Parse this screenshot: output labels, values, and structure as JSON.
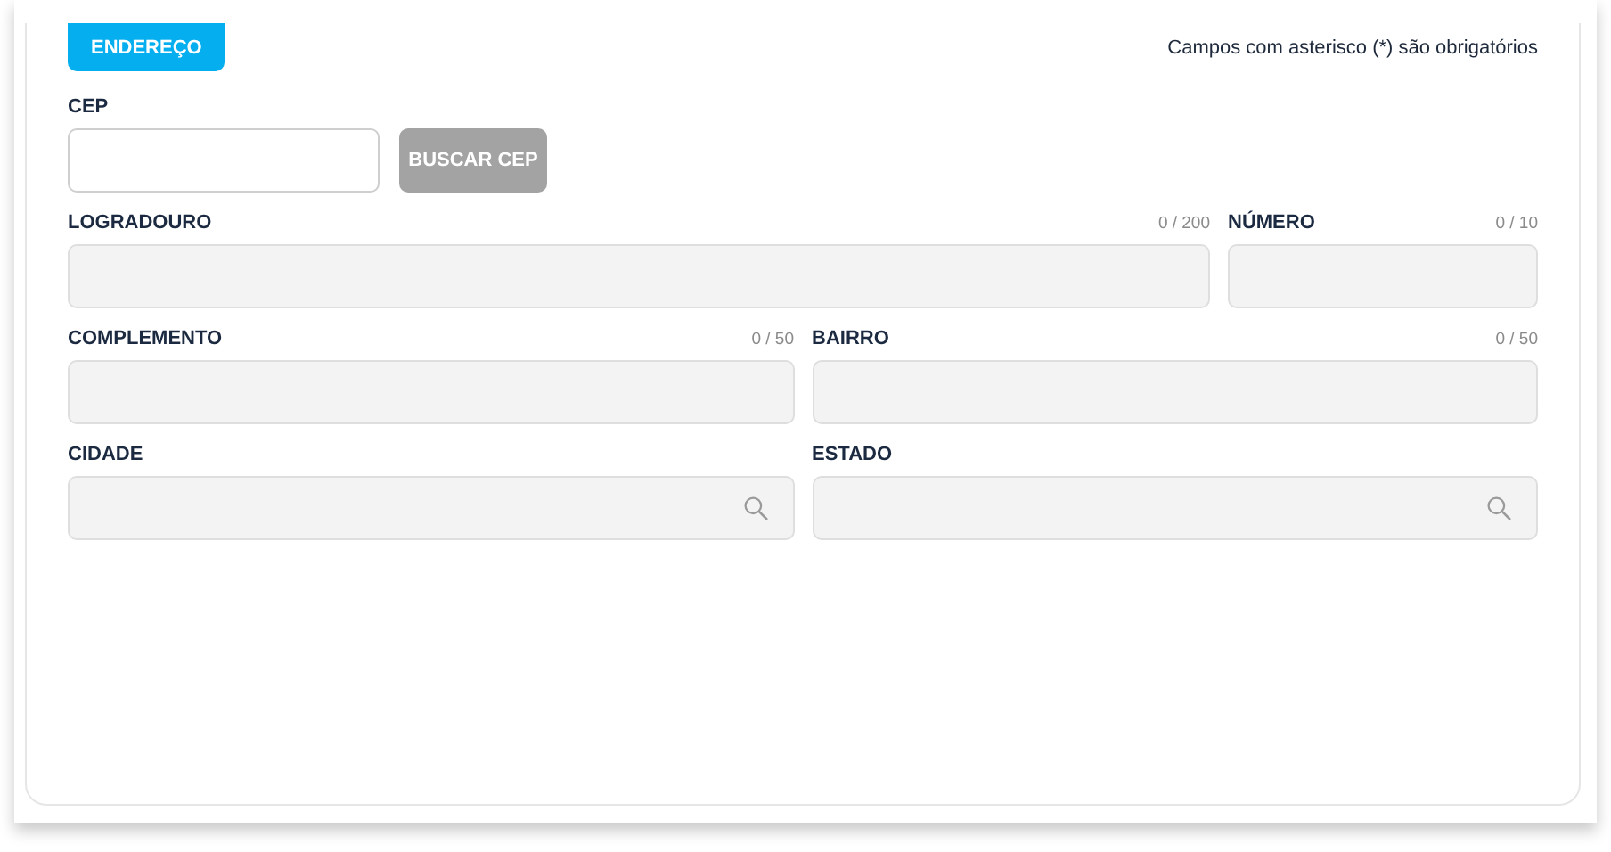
{
  "section_tab": {
    "label": "ENDEREÇO",
    "selected": true
  },
  "required_note": "Campos com asterisco (*) são obrigatórios",
  "cep": {
    "label": "CEP",
    "disabled": false,
    "button": {
      "label": "BUSCAR CEP",
      "disabled": true
    }
  },
  "rows": [
    [
      {
        "label": "LOGRADOURO",
        "counter": "0 / 200",
        "kind": "text",
        "disabled": true
      },
      {
        "label": "NÚMERO",
        "counter": "0 / 10",
        "kind": "text",
        "disabled": true
      }
    ],
    [
      {
        "label": "COMPLEMENTO",
        "counter": "0 / 50",
        "kind": "text",
        "disabled": true
      },
      {
        "label": "BAIRRO",
        "counter": "0 / 50",
        "kind": "text",
        "disabled": true
      }
    ],
    [
      {
        "label": "CIDADE",
        "kind": "search",
        "disabled": true
      },
      {
        "label": "ESTADO",
        "kind": "search",
        "disabled": true
      }
    ]
  ]
}
